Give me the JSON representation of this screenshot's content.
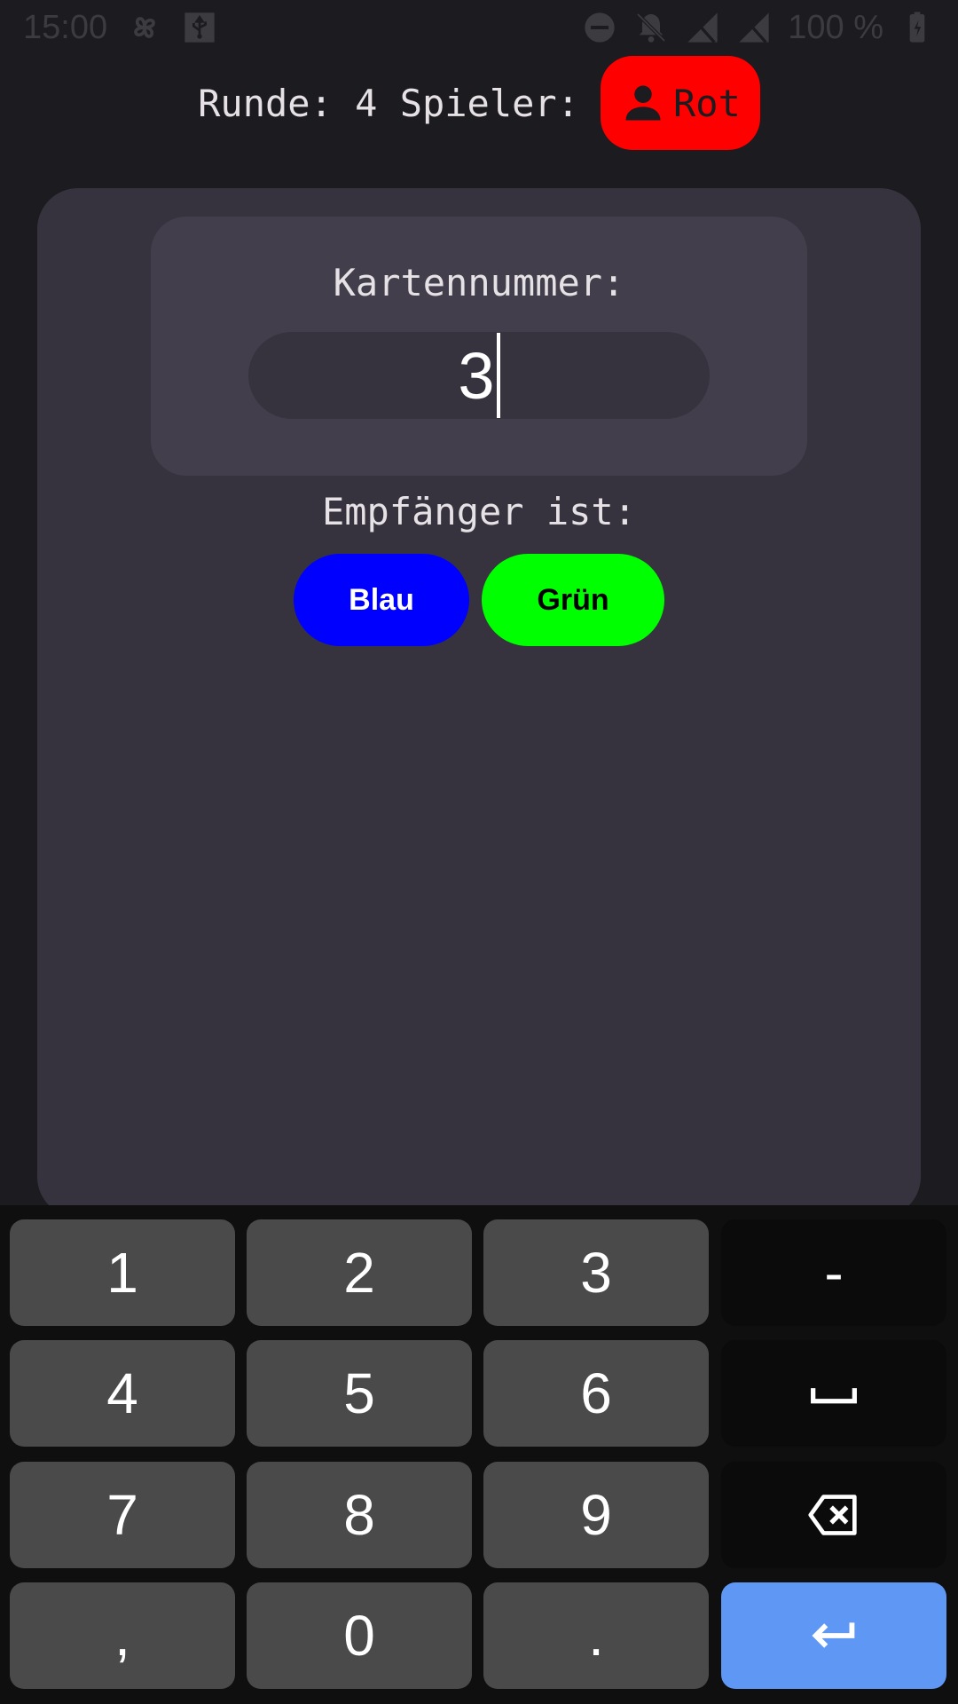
{
  "status_bar": {
    "time": "15:00",
    "battery": "100 %",
    "icons_left": [
      "pinwheel-icon",
      "usb-icon"
    ],
    "icons_right": [
      "dnd-icon",
      "notifications-off-icon",
      "no-signal-icon",
      "no-sim-icon",
      "battery-icon"
    ]
  },
  "header": {
    "round_text": "Runde: 4 Spieler:",
    "player_name": "Rot",
    "player_color": "#ff0000"
  },
  "card": {
    "label": "Kartennummer:",
    "value": "3"
  },
  "recipient": {
    "label": "Empfänger ist:",
    "options": [
      {
        "label": "Blau",
        "color": "#0000ff",
        "text_color": "#ffffff"
      },
      {
        "label": "Grün",
        "color": "#00ff00",
        "text_color": "#000000"
      }
    ]
  },
  "keyboard": {
    "keys": [
      "1",
      "2",
      "3",
      "-",
      "4",
      "5",
      "6",
      "space",
      "7",
      "8",
      "9",
      "backspace",
      ",",
      "0",
      ".",
      "enter"
    ],
    "accent_color": "#5f97f4"
  }
}
